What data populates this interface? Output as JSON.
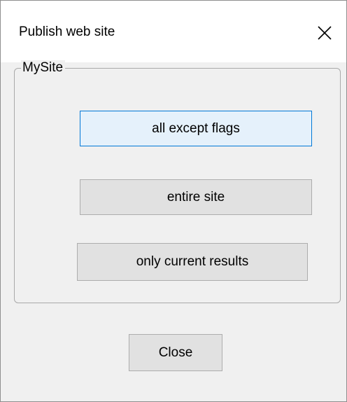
{
  "window": {
    "title": "Publish web site",
    "close_icon": "close-icon"
  },
  "group": {
    "label": "MySite",
    "buttons": [
      {
        "label": "all except flags",
        "is_default": true
      },
      {
        "label": "entire site",
        "is_default": false
      },
      {
        "label": "only current results",
        "is_default": false
      }
    ]
  },
  "footer": {
    "close_label": "Close"
  },
  "colors": {
    "default_button_border": "#0078d7",
    "default_button_fill": "#e5f1fb",
    "button_fill": "#e1e1e1",
    "button_border": "#adadad",
    "dialog_background": "#f0f0f0",
    "titlebar_background": "#ffffff"
  }
}
